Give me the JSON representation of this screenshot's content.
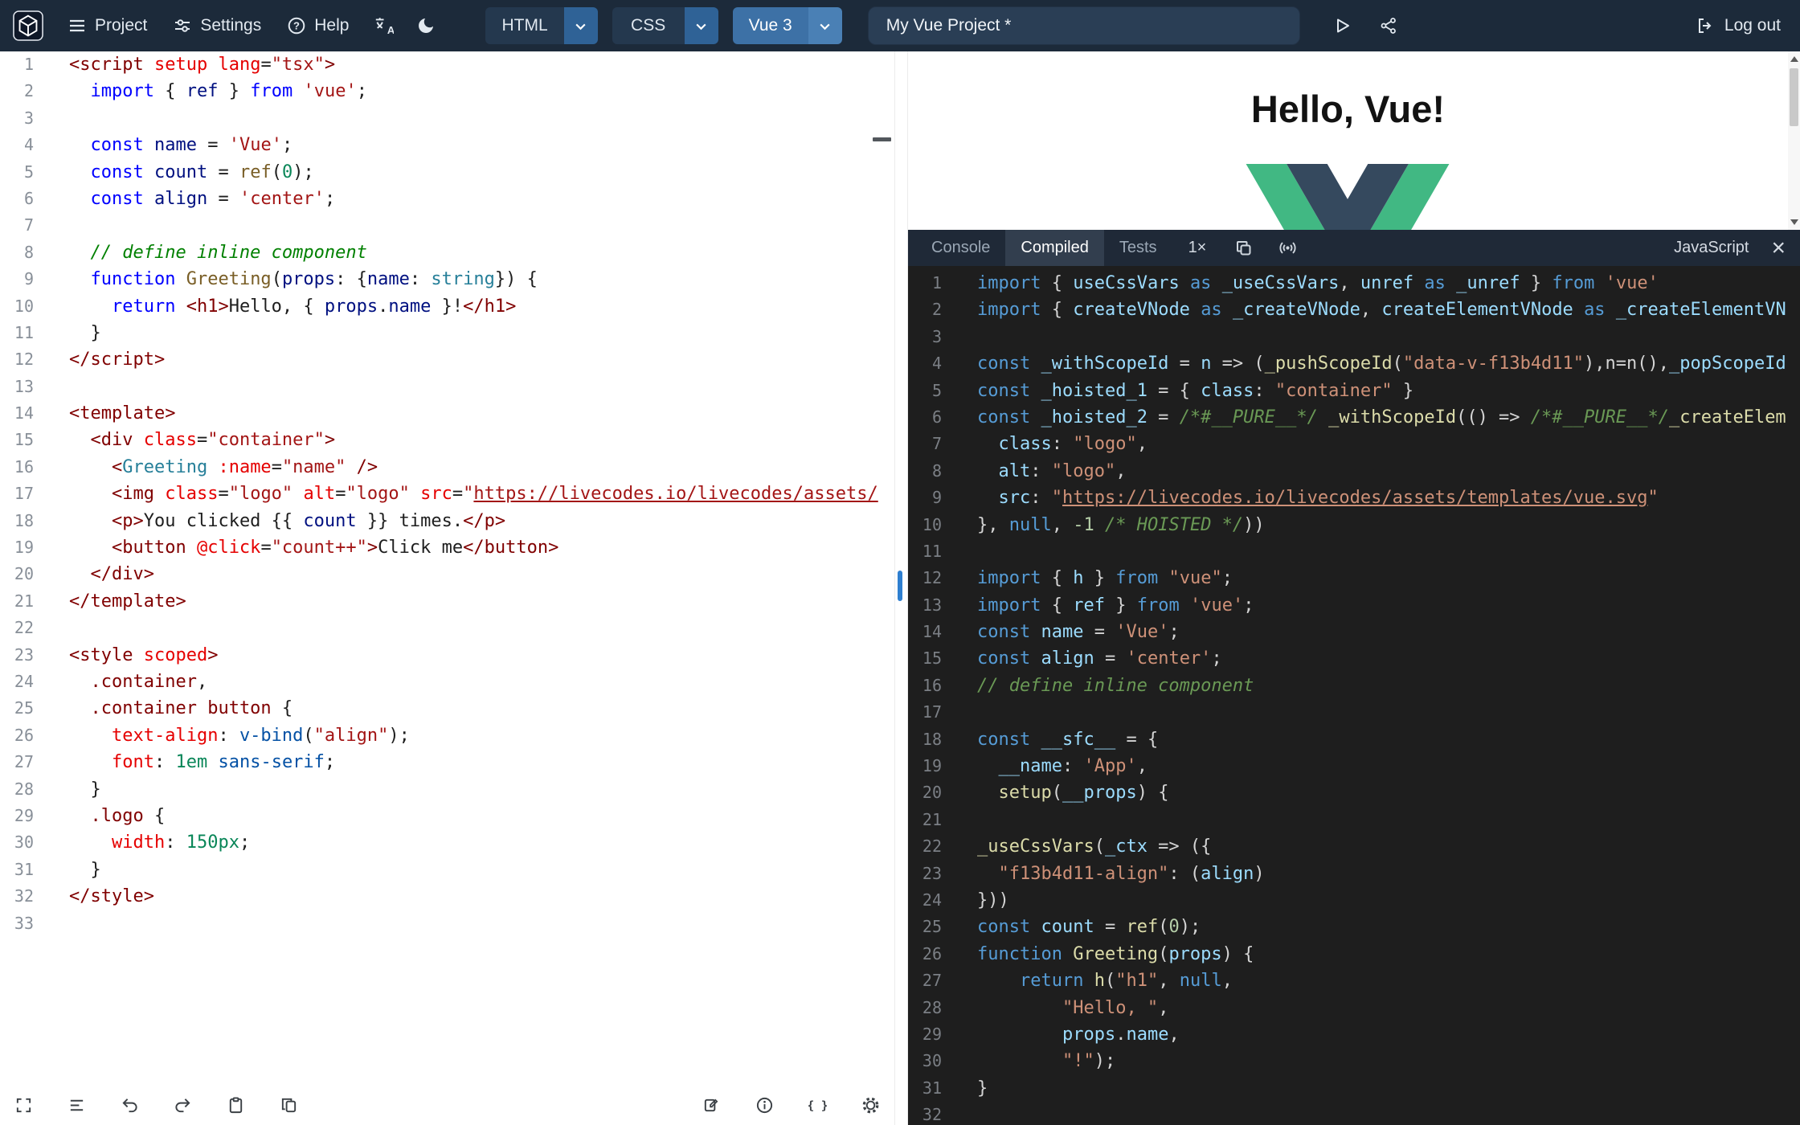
{
  "header": {
    "logo_name": "livecodes-logo",
    "menu": [
      {
        "label": "Project"
      },
      {
        "label": "Settings"
      },
      {
        "label": "Help"
      }
    ],
    "icon_buttons": [
      "translate-icon",
      "dark-mode-moon-icon"
    ],
    "editor_tabs": [
      {
        "label": "HTML",
        "active": false
      },
      {
        "label": "CSS",
        "active": false
      },
      {
        "label": "Vue 3",
        "active": true
      }
    ],
    "project_title": "My Vue Project *",
    "action_icons": [
      "run-icon",
      "share-icon"
    ],
    "logout_label": "Log out"
  },
  "colors": {
    "header_bg": "#1c2a3a",
    "accent_blue": "#3d71a6",
    "vue_green": "#41b883",
    "vue_navy": "#35495e",
    "dark_editor_bg": "#1e1e1e"
  },
  "editor": {
    "language": "Vue 3",
    "lines": [
      [
        [
          "t",
          "<script"
        ],
        [
          "p",
          " "
        ],
        [
          "a",
          "setup"
        ],
        [
          "p",
          " "
        ],
        [
          "a",
          "lang"
        ],
        [
          "p",
          "="
        ],
        [
          "s",
          "\"tsx\""
        ],
        [
          "t",
          ">"
        ]
      ],
      [
        [
          "p",
          "  "
        ],
        [
          "k",
          "import"
        ],
        [
          "p",
          " { "
        ],
        [
          "v",
          "ref"
        ],
        [
          "p",
          " } "
        ],
        [
          "k",
          "from"
        ],
        [
          "p",
          " "
        ],
        [
          "s",
          "'vue'"
        ],
        [
          "p",
          ";"
        ]
      ],
      [],
      [
        [
          "p",
          "  "
        ],
        [
          "k",
          "const"
        ],
        [
          "p",
          " "
        ],
        [
          "v",
          "name"
        ],
        [
          "p",
          " = "
        ],
        [
          "s",
          "'Vue'"
        ],
        [
          "p",
          ";"
        ]
      ],
      [
        [
          "p",
          "  "
        ],
        [
          "k",
          "const"
        ],
        [
          "p",
          " "
        ],
        [
          "v",
          "count"
        ],
        [
          "p",
          " = "
        ],
        [
          "f",
          "ref"
        ],
        [
          "p",
          "("
        ],
        [
          "n",
          "0"
        ],
        [
          "p",
          ");"
        ]
      ],
      [
        [
          "p",
          "  "
        ],
        [
          "k",
          "const"
        ],
        [
          "p",
          " "
        ],
        [
          "v",
          "align"
        ],
        [
          "p",
          " = "
        ],
        [
          "s",
          "'center'"
        ],
        [
          "p",
          ";"
        ]
      ],
      [],
      [
        [
          "p",
          "  "
        ],
        [
          "c",
          "// define inline component"
        ]
      ],
      [
        [
          "p",
          "  "
        ],
        [
          "k",
          "function"
        ],
        [
          "p",
          " "
        ],
        [
          "f",
          "Greeting"
        ],
        [
          "p",
          "("
        ],
        [
          "v",
          "props"
        ],
        [
          "p",
          ": {"
        ],
        [
          "v",
          "name"
        ],
        [
          "p",
          ": "
        ],
        [
          "y",
          "string"
        ],
        [
          "p",
          "}) {"
        ]
      ],
      [
        [
          "p",
          "    "
        ],
        [
          "k",
          "return"
        ],
        [
          "p",
          " "
        ],
        [
          "t",
          "<h1>"
        ],
        [
          "p",
          "Hello, { "
        ],
        [
          "v",
          "props"
        ],
        [
          "p",
          "."
        ],
        [
          "v",
          "name"
        ],
        [
          "p",
          " }!"
        ],
        [
          "t",
          "</h1>"
        ]
      ],
      [
        [
          "p",
          "  }"
        ]
      ],
      [
        [
          "t",
          "</script>"
        ]
      ],
      [],
      [
        [
          "t",
          "<template>"
        ]
      ],
      [
        [
          "p",
          "  "
        ],
        [
          "t",
          "<div"
        ],
        [
          "p",
          " "
        ],
        [
          "a",
          "class"
        ],
        [
          "p",
          "="
        ],
        [
          "s",
          "\"container\""
        ],
        [
          "t",
          ">"
        ]
      ],
      [
        [
          "p",
          "    "
        ],
        [
          "t",
          "<"
        ],
        [
          "y",
          "Greeting"
        ],
        [
          "p",
          " "
        ],
        [
          "a",
          ":name"
        ],
        [
          "p",
          "="
        ],
        [
          "s",
          "\"name\""
        ],
        [
          "p",
          " "
        ],
        [
          "t",
          "/>"
        ]
      ],
      [
        [
          "p",
          "    "
        ],
        [
          "t",
          "<img"
        ],
        [
          "p",
          " "
        ],
        [
          "a",
          "class"
        ],
        [
          "p",
          "="
        ],
        [
          "s",
          "\"logo\""
        ],
        [
          "p",
          " "
        ],
        [
          "a",
          "alt"
        ],
        [
          "p",
          "="
        ],
        [
          "s",
          "\"logo\""
        ],
        [
          "p",
          " "
        ],
        [
          "a",
          "src"
        ],
        [
          "p",
          "="
        ],
        [
          "s",
          "\""
        ],
        [
          "u",
          "https://livecodes.io/livecodes/assets/"
        ]
      ],
      [
        [
          "p",
          "    "
        ],
        [
          "t",
          "<p>"
        ],
        [
          "p",
          "You clicked {{ "
        ],
        [
          "v",
          "count"
        ],
        [
          "p",
          " }} times."
        ],
        [
          "t",
          "</p>"
        ]
      ],
      [
        [
          "p",
          "    "
        ],
        [
          "t",
          "<button"
        ],
        [
          "p",
          " "
        ],
        [
          "a",
          "@click"
        ],
        [
          "p",
          "="
        ],
        [
          "s",
          "\"count++\""
        ],
        [
          "t",
          ">"
        ],
        [
          "p",
          "Click me"
        ],
        [
          "t",
          "</button>"
        ]
      ],
      [
        [
          "p",
          "  "
        ],
        [
          "t",
          "</div>"
        ]
      ],
      [
        [
          "t",
          "</template>"
        ]
      ],
      [],
      [
        [
          "t",
          "<style"
        ],
        [
          "p",
          " "
        ],
        [
          "a",
          "scoped"
        ],
        [
          "t",
          ">"
        ]
      ],
      [
        [
          "p",
          "  "
        ],
        [
          "cs",
          ".container"
        ],
        [
          "p",
          ","
        ]
      ],
      [
        [
          "p",
          "  "
        ],
        [
          "cs",
          ".container"
        ],
        [
          "p",
          " "
        ],
        [
          "cs",
          "button"
        ],
        [
          "p",
          " {"
        ]
      ],
      [
        [
          "p",
          "    "
        ],
        [
          "cp",
          "text-align"
        ],
        [
          "p",
          ": "
        ],
        [
          "cv",
          "v-bind"
        ],
        [
          "p",
          "("
        ],
        [
          "s",
          "\"align\""
        ],
        [
          "p",
          ");"
        ]
      ],
      [
        [
          "p",
          "    "
        ],
        [
          "cp",
          "font"
        ],
        [
          "p",
          ": "
        ],
        [
          "n",
          "1em"
        ],
        [
          "p",
          " "
        ],
        [
          "cv",
          "sans-serif"
        ],
        [
          "p",
          ";"
        ]
      ],
      [
        [
          "p",
          "  }"
        ]
      ],
      [
        [
          "p",
          "  "
        ],
        [
          "cs",
          ".logo"
        ],
        [
          "p",
          " {"
        ]
      ],
      [
        [
          "p",
          "    "
        ],
        [
          "cp",
          "width"
        ],
        [
          "p",
          ": "
        ],
        [
          "n",
          "150px"
        ],
        [
          "p",
          ";"
        ]
      ],
      [
        [
          "p",
          "  }"
        ]
      ],
      [
        [
          "t",
          "</style>"
        ]
      ],
      []
    ]
  },
  "editor_toolbar": {
    "left_icons": [
      "focus-icon",
      "format-icon",
      "undo-icon",
      "redo-icon",
      "paste-icon",
      "copy-code-icon"
    ],
    "right_icons": [
      "external-editor-icon",
      "info-icon",
      "braces-icon",
      "settings-icon"
    ]
  },
  "preview": {
    "heading": "Hello, Vue!"
  },
  "tools": {
    "tabs": [
      {
        "label": "Console",
        "active": false
      },
      {
        "label": "Compiled",
        "active": true
      },
      {
        "label": "Tests",
        "active": false
      }
    ],
    "zoom_label": "1×",
    "header_icons": [
      "copy-icon",
      "broadcast-icon"
    ],
    "language_label": "JavaScript",
    "close_label": "×"
  },
  "compiled": {
    "language": "JavaScript",
    "lines": [
      [
        [
          "k",
          "import"
        ],
        [
          "p",
          " { "
        ],
        [
          "v",
          "useCssVars"
        ],
        [
          "p",
          " "
        ],
        [
          "k",
          "as"
        ],
        [
          "p",
          " "
        ],
        [
          "v",
          "_useCssVars"
        ],
        [
          "p",
          ", "
        ],
        [
          "v",
          "unref"
        ],
        [
          "p",
          " "
        ],
        [
          "k",
          "as"
        ],
        [
          "p",
          " "
        ],
        [
          "v",
          "_unref"
        ],
        [
          "p",
          " } "
        ],
        [
          "k",
          "from"
        ],
        [
          "p",
          " "
        ],
        [
          "s",
          "'vue'"
        ]
      ],
      [
        [
          "k",
          "import"
        ],
        [
          "p",
          " { "
        ],
        [
          "v",
          "createVNode"
        ],
        [
          "p",
          " "
        ],
        [
          "k",
          "as"
        ],
        [
          "p",
          " "
        ],
        [
          "v",
          "_createVNode"
        ],
        [
          "p",
          ", "
        ],
        [
          "v",
          "createElementVNode"
        ],
        [
          "p",
          " "
        ],
        [
          "k",
          "as"
        ],
        [
          "p",
          " "
        ],
        [
          "v",
          "_createElementVN"
        ]
      ],
      [],
      [
        [
          "k",
          "const"
        ],
        [
          "p",
          " "
        ],
        [
          "v",
          "_withScopeId"
        ],
        [
          "p",
          " = "
        ],
        [
          "v",
          "n"
        ],
        [
          "p",
          " => ("
        ],
        [
          "f",
          "_pushScopeId"
        ],
        [
          "p",
          "("
        ],
        [
          "s",
          "\"data-v-f13b4d11\""
        ],
        [
          "p",
          "),n=n(),"
        ],
        [
          "v",
          "_popScopeId"
        ]
      ],
      [
        [
          "k",
          "const"
        ],
        [
          "p",
          " "
        ],
        [
          "v",
          "_hoisted_1"
        ],
        [
          "p",
          " = { "
        ],
        [
          "v",
          "class"
        ],
        [
          "p",
          ": "
        ],
        [
          "s",
          "\"container\""
        ],
        [
          "p",
          " }"
        ]
      ],
      [
        [
          "k",
          "const"
        ],
        [
          "p",
          " "
        ],
        [
          "v",
          "_hoisted_2"
        ],
        [
          "p",
          " = "
        ],
        [
          "c",
          "/*#__PURE__*/"
        ],
        [
          "p",
          " "
        ],
        [
          "f",
          "_withScopeId"
        ],
        [
          "p",
          "(() => "
        ],
        [
          "c",
          "/*#__PURE__*/"
        ],
        [
          "f",
          "_createElem"
        ]
      ],
      [
        [
          "p",
          "  "
        ],
        [
          "v",
          "class"
        ],
        [
          "p",
          ": "
        ],
        [
          "s",
          "\"logo\""
        ],
        [
          "p",
          ","
        ]
      ],
      [
        [
          "p",
          "  "
        ],
        [
          "v",
          "alt"
        ],
        [
          "p",
          ": "
        ],
        [
          "s",
          "\"logo\""
        ],
        [
          "p",
          ","
        ]
      ],
      [
        [
          "p",
          "  "
        ],
        [
          "v",
          "src"
        ],
        [
          "p",
          ": "
        ],
        [
          "s",
          "\""
        ],
        [
          "u",
          "https://livecodes.io/livecodes/assets/templates/vue.svg"
        ],
        [
          "s",
          "\""
        ]
      ],
      [
        [
          "p",
          "}, "
        ],
        [
          "k",
          "null"
        ],
        [
          "p",
          ", "
        ],
        [
          "n",
          "-1"
        ],
        [
          "p",
          " "
        ],
        [
          "c",
          "/* HOISTED */"
        ],
        [
          "p",
          "))"
        ]
      ],
      [],
      [
        [
          "k",
          "import"
        ],
        [
          "p",
          " { "
        ],
        [
          "v",
          "h"
        ],
        [
          "p",
          " } "
        ],
        [
          "k",
          "from"
        ],
        [
          "p",
          " "
        ],
        [
          "s",
          "\"vue\""
        ],
        [
          "p",
          ";"
        ]
      ],
      [
        [
          "k",
          "import"
        ],
        [
          "p",
          " { "
        ],
        [
          "v",
          "ref"
        ],
        [
          "p",
          " } "
        ],
        [
          "k",
          "from"
        ],
        [
          "p",
          " "
        ],
        [
          "s",
          "'vue'"
        ],
        [
          "p",
          ";"
        ]
      ],
      [
        [
          "k",
          "const"
        ],
        [
          "p",
          " "
        ],
        [
          "v",
          "name"
        ],
        [
          "p",
          " = "
        ],
        [
          "s",
          "'Vue'"
        ],
        [
          "p",
          ";"
        ]
      ],
      [
        [
          "k",
          "const"
        ],
        [
          "p",
          " "
        ],
        [
          "v",
          "align"
        ],
        [
          "p",
          " = "
        ],
        [
          "s",
          "'center'"
        ],
        [
          "p",
          ";"
        ]
      ],
      [
        [
          "c",
          "// define inline component"
        ]
      ],
      [],
      [
        [
          "k",
          "const"
        ],
        [
          "p",
          " "
        ],
        [
          "v",
          "__sfc__"
        ],
        [
          "p",
          " = {"
        ]
      ],
      [
        [
          "p",
          "  "
        ],
        [
          "v",
          "__name"
        ],
        [
          "p",
          ": "
        ],
        [
          "s",
          "'App'"
        ],
        [
          "p",
          ","
        ]
      ],
      [
        [
          "p",
          "  "
        ],
        [
          "f",
          "setup"
        ],
        [
          "p",
          "("
        ],
        [
          "v",
          "__props"
        ],
        [
          "p",
          ") {"
        ]
      ],
      [],
      [
        [
          "f",
          "_useCssVars"
        ],
        [
          "p",
          "("
        ],
        [
          "v",
          "_ctx"
        ],
        [
          "p",
          " => ({"
        ]
      ],
      [
        [
          "p",
          "  "
        ],
        [
          "s",
          "\"f13b4d11-align\""
        ],
        [
          "p",
          ": ("
        ],
        [
          "v",
          "align"
        ],
        [
          "p",
          ")"
        ]
      ],
      [
        [
          "p",
          "}))"
        ]
      ],
      [
        [
          "k",
          "const"
        ],
        [
          "p",
          " "
        ],
        [
          "v",
          "count"
        ],
        [
          "p",
          " = "
        ],
        [
          "f",
          "ref"
        ],
        [
          "p",
          "("
        ],
        [
          "n",
          "0"
        ],
        [
          "p",
          ");"
        ]
      ],
      [
        [
          "k",
          "function"
        ],
        [
          "p",
          " "
        ],
        [
          "f",
          "Greeting"
        ],
        [
          "p",
          "("
        ],
        [
          "v",
          "props"
        ],
        [
          "p",
          ") {"
        ]
      ],
      [
        [
          "p",
          "    "
        ],
        [
          "k",
          "return"
        ],
        [
          "p",
          " "
        ],
        [
          "f",
          "h"
        ],
        [
          "p",
          "("
        ],
        [
          "s",
          "\"h1\""
        ],
        [
          "p",
          ", "
        ],
        [
          "k",
          "null"
        ],
        [
          "p",
          ","
        ]
      ],
      [
        [
          "p",
          "        "
        ],
        [
          "s",
          "\"Hello, \""
        ],
        [
          "p",
          ","
        ]
      ],
      [
        [
          "p",
          "        "
        ],
        [
          "v",
          "props"
        ],
        [
          "p",
          "."
        ],
        [
          "v",
          "name"
        ],
        [
          "p",
          ","
        ]
      ],
      [
        [
          "p",
          "        "
        ],
        [
          "s",
          "\"!\""
        ],
        [
          "p",
          ");"
        ]
      ],
      [
        [
          "p",
          "}"
        ]
      ],
      []
    ]
  }
}
